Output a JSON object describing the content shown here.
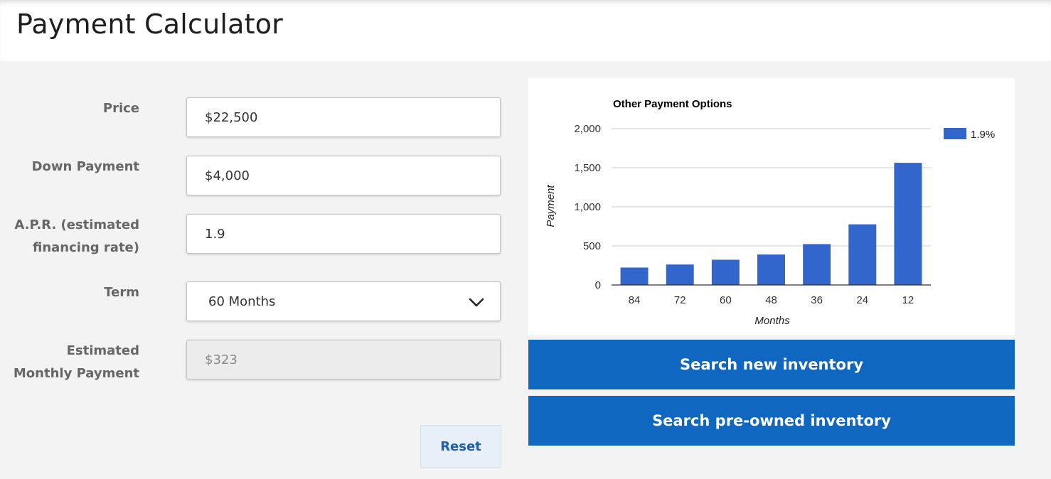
{
  "page": {
    "title": "Payment Calculator"
  },
  "form": {
    "price": {
      "label": "Price",
      "value": "$22,500"
    },
    "down_payment": {
      "label": "Down Payment",
      "value": "$4,000"
    },
    "apr": {
      "label_line1": "A.P.R. (estimated",
      "label_line2": "financing rate)",
      "value": "1.9"
    },
    "term": {
      "label": "Term",
      "value": "60 Months"
    },
    "monthly_payment": {
      "label_line1": "Estimated",
      "label_line2": "Monthly Payment",
      "value": "$323"
    },
    "reset_label": "Reset"
  },
  "actions": {
    "search_new": "Search new inventory",
    "search_preowned": "Search pre-owned inventory"
  },
  "colors": {
    "accent": "#0f67c0",
    "bar": "#3366cc"
  },
  "chart_data": {
    "type": "bar",
    "title": "Other Payment Options",
    "xlabel": "Months",
    "ylabel": "Payment",
    "categories": [
      "84",
      "72",
      "60",
      "48",
      "36",
      "24",
      "12"
    ],
    "series": [
      {
        "name": "1.9%",
        "values": [
          223,
          262,
          323,
          390,
          523,
          776,
          1563
        ]
      }
    ],
    "ylim": [
      0,
      2000
    ],
    "yticks": [
      0,
      500,
      1000,
      1500,
      2000
    ],
    "ytick_labels": [
      "0",
      "500",
      "1,000",
      "1,500",
      "2,000"
    ],
    "grid": true,
    "legend": "top-right"
  }
}
